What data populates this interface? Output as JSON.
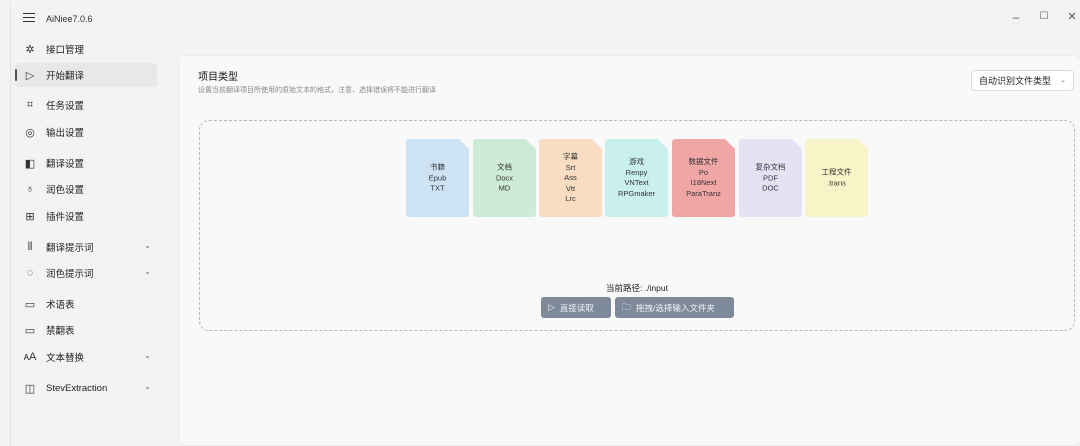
{
  "app": {
    "title": "AiNiee7.0.6",
    "window_controls": {
      "minimize": "–",
      "maximize": "☐",
      "close": "✕"
    }
  },
  "sidebar": {
    "items": [
      {
        "label": "接口管理",
        "icon": "network-icon",
        "glyph": "✲",
        "active": false,
        "expandable": false
      },
      {
        "label": "开始翻译",
        "icon": "play-icon",
        "glyph": "▷",
        "active": true,
        "expandable": false
      },
      {
        "label": "任务设置",
        "icon": "task-icon",
        "glyph": "⌗",
        "active": false,
        "expandable": false
      },
      {
        "label": "输出设置",
        "icon": "output-icon",
        "glyph": "◎",
        "active": false,
        "expandable": false
      },
      {
        "label": "翻译设置",
        "icon": "translate-icon",
        "glyph": "◧",
        "active": false,
        "expandable": false
      },
      {
        "label": "润色设置",
        "icon": "brush-icon",
        "glyph": "♁",
        "active": false,
        "expandable": false
      },
      {
        "label": "插件设置",
        "icon": "plugin-icon",
        "glyph": "⊞",
        "active": false,
        "expandable": false
      },
      {
        "label": "翻译提示词",
        "icon": "library-icon",
        "glyph": "⫴",
        "active": false,
        "expandable": true
      },
      {
        "label": "润色提示词",
        "icon": "palette-icon",
        "glyph": "◌",
        "active": false,
        "expandable": true
      },
      {
        "label": "术语表",
        "icon": "book-icon",
        "glyph": "▭",
        "active": false,
        "expandable": false
      },
      {
        "label": "禁翻表",
        "icon": "book-icon",
        "glyph": "▭",
        "active": false,
        "expandable": false
      },
      {
        "label": "文本替换",
        "icon": "font-icon",
        "glyph": "ᴀA",
        "active": false,
        "expandable": true
      },
      {
        "label": "StevExtraction",
        "icon": "extract-icon",
        "glyph": "◫",
        "active": false,
        "expandable": true
      }
    ],
    "chevron": "⌄"
  },
  "main": {
    "section_title": "项目类型",
    "section_desc": "设置当前翻译项目所使用的原始文本的格式，注意，选择错误将不能进行翻译",
    "dropdown": {
      "value": "自动识别文件类型",
      "chevron": "⌄"
    },
    "file_types": [
      {
        "lines": [
          "书籍",
          "Epub",
          "TXT"
        ],
        "color": "#cde3f4"
      },
      {
        "lines": [
          "文档",
          "Docx",
          "MD"
        ],
        "color": "#cdebd6"
      },
      {
        "lines": [
          "字幕",
          "Srt",
          "Ass",
          "Vtt",
          "Lrc"
        ],
        "color": "#f9dcc2"
      },
      {
        "lines": [
          "游戏",
          "Renpy",
          "VNText",
          "RPGmaker"
        ],
        "color": "#c9f0ee"
      },
      {
        "lines": [
          "数据文件",
          "Po",
          "I18Next",
          "ParaTranz"
        ],
        "color": "#f1a6a6"
      },
      {
        "lines": [
          "复杂文档",
          "PDF",
          "DOC"
        ],
        "color": "#e4e3f6"
      },
      {
        "lines": [
          "工程文件",
          ".trans"
        ],
        "color": "#f8f4c8"
      }
    ],
    "current_path": "当前路径: ./input",
    "buttons": {
      "read": {
        "label": "直接读取",
        "icon": "play-icon",
        "glyph": "▷"
      },
      "select": {
        "label": "拖拽/选择输入文件夹",
        "icon": "folder-icon",
        "glyph": "🗀"
      }
    }
  }
}
